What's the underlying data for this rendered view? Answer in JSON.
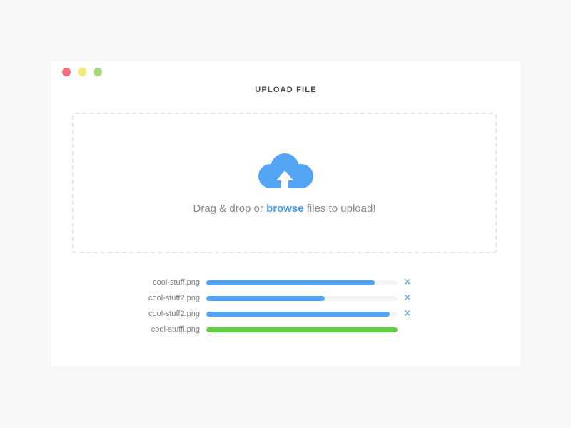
{
  "window": {
    "title": "UPLOAD FILE"
  },
  "dropzone": {
    "text_before": "Drag & drop or",
    "link": "browse",
    "text_after": "files to upload!",
    "icon": "cloud-upload-icon"
  },
  "colors": {
    "accent": "#4a9cf0",
    "progress": "#54a4f5",
    "complete": "#5ed13d",
    "close": "#f56c7a",
    "minimize": "#f3ea79",
    "zoom": "#a6d87a"
  },
  "files": [
    {
      "name": "cool-stuff.png",
      "progress": 0.88,
      "complete": false,
      "remove": "×"
    },
    {
      "name": "cool-stuff2.png",
      "progress": 0.62,
      "complete": false,
      "remove": "×"
    },
    {
      "name": "cool-stuff2.png",
      "progress": 0.96,
      "complete": false,
      "remove": "×"
    },
    {
      "name": "cool-stuffl.png",
      "progress": 1.0,
      "complete": true,
      "remove": ""
    }
  ]
}
